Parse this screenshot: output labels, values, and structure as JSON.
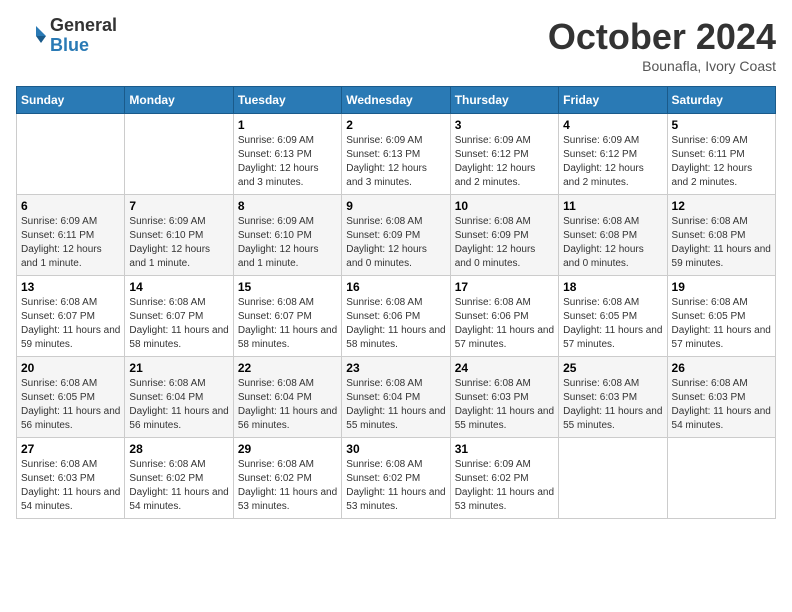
{
  "header": {
    "logo_line1": "General",
    "logo_line2": "Blue",
    "month": "October 2024",
    "location": "Bounafla, Ivory Coast"
  },
  "weekdays": [
    "Sunday",
    "Monday",
    "Tuesday",
    "Wednesday",
    "Thursday",
    "Friday",
    "Saturday"
  ],
  "weeks": [
    [
      {
        "day": "",
        "info": ""
      },
      {
        "day": "",
        "info": ""
      },
      {
        "day": "1",
        "info": "Sunrise: 6:09 AM\nSunset: 6:13 PM\nDaylight: 12 hours and 3 minutes."
      },
      {
        "day": "2",
        "info": "Sunrise: 6:09 AM\nSunset: 6:13 PM\nDaylight: 12 hours and 3 minutes."
      },
      {
        "day": "3",
        "info": "Sunrise: 6:09 AM\nSunset: 6:12 PM\nDaylight: 12 hours and 2 minutes."
      },
      {
        "day": "4",
        "info": "Sunrise: 6:09 AM\nSunset: 6:12 PM\nDaylight: 12 hours and 2 minutes."
      },
      {
        "day": "5",
        "info": "Sunrise: 6:09 AM\nSunset: 6:11 PM\nDaylight: 12 hours and 2 minutes."
      }
    ],
    [
      {
        "day": "6",
        "info": "Sunrise: 6:09 AM\nSunset: 6:11 PM\nDaylight: 12 hours and 1 minute."
      },
      {
        "day": "7",
        "info": "Sunrise: 6:09 AM\nSunset: 6:10 PM\nDaylight: 12 hours and 1 minute."
      },
      {
        "day": "8",
        "info": "Sunrise: 6:09 AM\nSunset: 6:10 PM\nDaylight: 12 hours and 1 minute."
      },
      {
        "day": "9",
        "info": "Sunrise: 6:08 AM\nSunset: 6:09 PM\nDaylight: 12 hours and 0 minutes."
      },
      {
        "day": "10",
        "info": "Sunrise: 6:08 AM\nSunset: 6:09 PM\nDaylight: 12 hours and 0 minutes."
      },
      {
        "day": "11",
        "info": "Sunrise: 6:08 AM\nSunset: 6:08 PM\nDaylight: 12 hours and 0 minutes."
      },
      {
        "day": "12",
        "info": "Sunrise: 6:08 AM\nSunset: 6:08 PM\nDaylight: 11 hours and 59 minutes."
      }
    ],
    [
      {
        "day": "13",
        "info": "Sunrise: 6:08 AM\nSunset: 6:07 PM\nDaylight: 11 hours and 59 minutes."
      },
      {
        "day": "14",
        "info": "Sunrise: 6:08 AM\nSunset: 6:07 PM\nDaylight: 11 hours and 58 minutes."
      },
      {
        "day": "15",
        "info": "Sunrise: 6:08 AM\nSunset: 6:07 PM\nDaylight: 11 hours and 58 minutes."
      },
      {
        "day": "16",
        "info": "Sunrise: 6:08 AM\nSunset: 6:06 PM\nDaylight: 11 hours and 58 minutes."
      },
      {
        "day": "17",
        "info": "Sunrise: 6:08 AM\nSunset: 6:06 PM\nDaylight: 11 hours and 57 minutes."
      },
      {
        "day": "18",
        "info": "Sunrise: 6:08 AM\nSunset: 6:05 PM\nDaylight: 11 hours and 57 minutes."
      },
      {
        "day": "19",
        "info": "Sunrise: 6:08 AM\nSunset: 6:05 PM\nDaylight: 11 hours and 57 minutes."
      }
    ],
    [
      {
        "day": "20",
        "info": "Sunrise: 6:08 AM\nSunset: 6:05 PM\nDaylight: 11 hours and 56 minutes."
      },
      {
        "day": "21",
        "info": "Sunrise: 6:08 AM\nSunset: 6:04 PM\nDaylight: 11 hours and 56 minutes."
      },
      {
        "day": "22",
        "info": "Sunrise: 6:08 AM\nSunset: 6:04 PM\nDaylight: 11 hours and 56 minutes."
      },
      {
        "day": "23",
        "info": "Sunrise: 6:08 AM\nSunset: 6:04 PM\nDaylight: 11 hours and 55 minutes."
      },
      {
        "day": "24",
        "info": "Sunrise: 6:08 AM\nSunset: 6:03 PM\nDaylight: 11 hours and 55 minutes."
      },
      {
        "day": "25",
        "info": "Sunrise: 6:08 AM\nSunset: 6:03 PM\nDaylight: 11 hours and 55 minutes."
      },
      {
        "day": "26",
        "info": "Sunrise: 6:08 AM\nSunset: 6:03 PM\nDaylight: 11 hours and 54 minutes."
      }
    ],
    [
      {
        "day": "27",
        "info": "Sunrise: 6:08 AM\nSunset: 6:03 PM\nDaylight: 11 hours and 54 minutes."
      },
      {
        "day": "28",
        "info": "Sunrise: 6:08 AM\nSunset: 6:02 PM\nDaylight: 11 hours and 54 minutes."
      },
      {
        "day": "29",
        "info": "Sunrise: 6:08 AM\nSunset: 6:02 PM\nDaylight: 11 hours and 53 minutes."
      },
      {
        "day": "30",
        "info": "Sunrise: 6:08 AM\nSunset: 6:02 PM\nDaylight: 11 hours and 53 minutes."
      },
      {
        "day": "31",
        "info": "Sunrise: 6:09 AM\nSunset: 6:02 PM\nDaylight: 11 hours and 53 minutes."
      },
      {
        "day": "",
        "info": ""
      },
      {
        "day": "",
        "info": ""
      }
    ]
  ]
}
